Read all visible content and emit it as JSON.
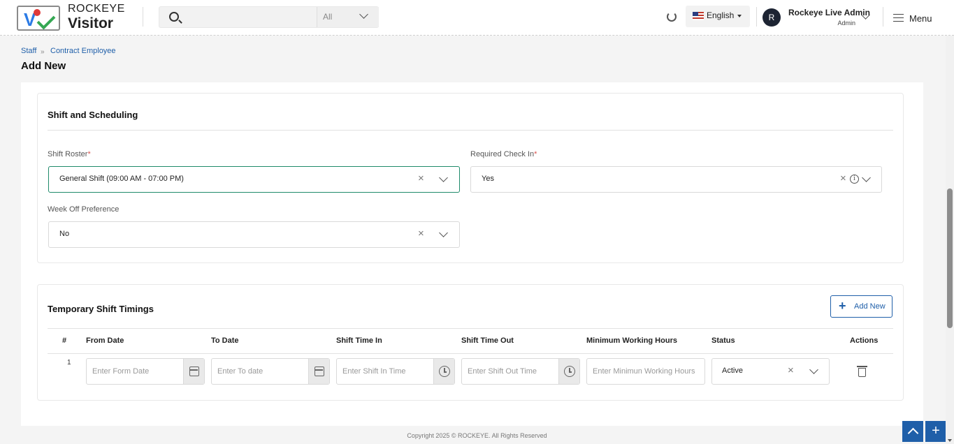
{
  "header": {
    "brand_top": "ROCKEYE",
    "brand_bottom": "Visitor",
    "search_placeholder": "",
    "search_scope": "All",
    "language": "English",
    "user_initial": "R",
    "user_name": "Rockeye Live Admin",
    "user_role": "Admin",
    "menu_label": "Menu"
  },
  "breadcrumb": {
    "items": [
      "Staff",
      "Contract Employee"
    ]
  },
  "page_title": "Add New",
  "shift_section": {
    "title": "Shift and Scheduling",
    "shift_roster_label": "Shift Roster",
    "shift_roster_value": "General Shift (09:00 AM - 07:00 PM)",
    "required_checkin_label": "Required Check In",
    "required_checkin_value": "Yes",
    "week_off_label": "Week Off Preference",
    "week_off_value": "No",
    "required_marker": "*"
  },
  "temp_section": {
    "title": "Temporary Shift Timings",
    "add_button": "Add New",
    "columns": [
      "#",
      "From Date",
      "To Date",
      "Shift Time In",
      "Shift Time Out",
      "Minimum Working Hours",
      "Status",
      "Actions"
    ],
    "rows": [
      {
        "num": "1",
        "from_placeholder": "Enter Form Date",
        "to_placeholder": "Enter To date",
        "time_in_placeholder": "Enter Shift In Time",
        "time_out_placeholder": "Enter  Shift Out Time",
        "min_hours_placeholder": "Enter Minimun Working Hours",
        "status": "Active"
      }
    ]
  },
  "footer": {
    "copyright": "Copyright 2025 © ROCKEYE. All Rights Reserved"
  },
  "colors": {
    "accent": "#1f5fa9",
    "active_border": "#1f8a6a",
    "required": "#d9534f"
  }
}
